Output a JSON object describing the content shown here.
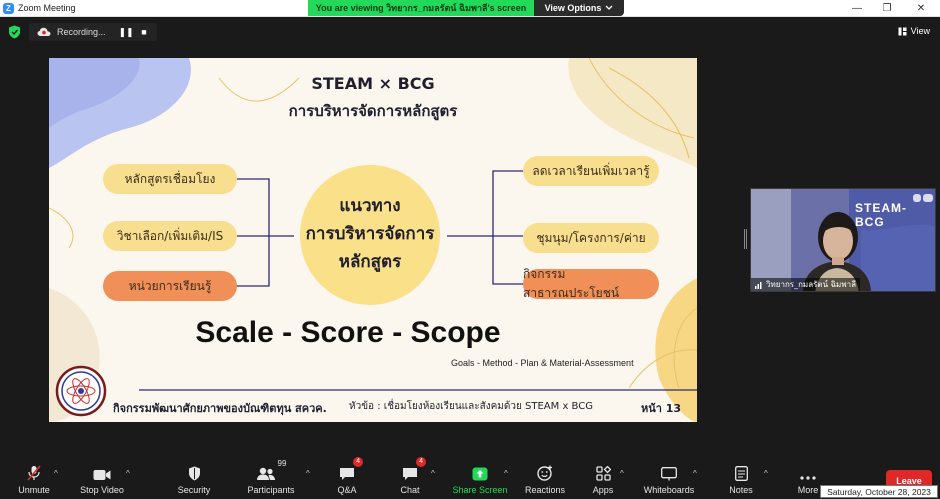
{
  "window": {
    "title": "Zoom Meeting",
    "minimize": "—",
    "restore": "❐",
    "close": "✕"
  },
  "banner": {
    "viewing": "You are viewing วิทยากร_กมลรัตน์ ฉิมพาลี's screen",
    "view_options": "View Options"
  },
  "recording": {
    "label": "Recording...",
    "pause": "❚❚",
    "stop": "■"
  },
  "view": {
    "label": "View"
  },
  "slide": {
    "title1": "STEAM × BCG",
    "title2": "การบริหารจัดการหลักสูตร",
    "center1": "แนวทาง",
    "center2": "การบริหารจัดการ",
    "center3": "หลักสูตร",
    "left_items": [
      "หลักสูตรเชื่อมโยง",
      "วิชาเลือก/เพิ่มเติม/IS",
      "หน่วยการเรียนรู้"
    ],
    "right_items": [
      "ลดเวลาเรียนเพิ่มเวลารู้",
      "ชุมนุม/โครงการ/ค่าย",
      "กิจกรรมสาธารณประโยชน์"
    ],
    "scale": "Scale - Score - Scope",
    "goals": "Goals - Method - Plan & Material-Assessment",
    "footer": "กิจกรรมพัฒนาศักยภาพของบัณฑิตทุน สควค.",
    "footer_topic": "หัวข้อ : เชื่อมโยงห้องเรียนและสังคมด้วย STEAM x BCG",
    "page": "หน้า 13"
  },
  "video": {
    "name": "วิทยากร_กมลรัตน์ ฉิมพาลี",
    "bg_text": "STEAM-BCG"
  },
  "toolbar": {
    "unmute": "Unmute",
    "stop_video": "Stop Video",
    "security": "Security",
    "participants": "Participants",
    "participants_count": "99",
    "qa": "Q&A",
    "qa_badge": "4",
    "chat": "Chat",
    "chat_badge": "4",
    "share": "Share Screen",
    "reactions": "Reactions",
    "apps": "Apps",
    "whiteboards": "Whiteboards",
    "notes": "Notes",
    "more": "More",
    "leave": "Leave"
  },
  "tooltip": {
    "date": "Saturday, October 28, 2023"
  },
  "colors": {
    "accent_green": "#23d959",
    "leave_red": "#e02828",
    "pill_yellow": "#f8df8f",
    "pill_orange": "#f08f57",
    "center_yellow": "#fbe08a",
    "line_navy": "#2e2a6e"
  }
}
